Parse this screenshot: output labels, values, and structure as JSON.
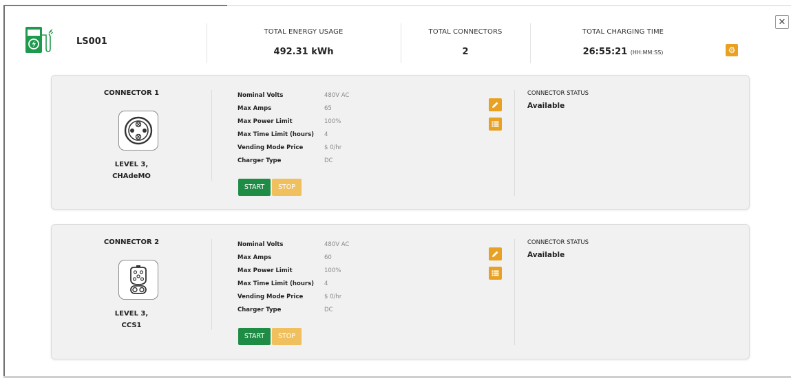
{
  "station": {
    "id": "LS001",
    "icon": "ev-charging-station-icon",
    "icon_color": "#1e9a4d"
  },
  "stats": [
    {
      "label": "TOTAL ENERGY USAGE",
      "value": "492.31 kWh",
      "unit": ""
    },
    {
      "label": "TOTAL CONNECTORS",
      "value": "2",
      "unit": ""
    },
    {
      "label": "TOTAL CHARGING TIME",
      "value": "26:55:21",
      "unit": "(HH:MM:SS)"
    }
  ],
  "connectors": [
    {
      "title": "CONNECTOR 1",
      "icon": "chademo-plug-icon",
      "type_line1": "LEVEL 3,",
      "type_line2": "CHAdeMO",
      "specs": [
        {
          "label": "Nominal Volts",
          "value": "480V AC"
        },
        {
          "label": "Max Amps",
          "value": "65"
        },
        {
          "label": "Max Power Limit",
          "value": "100%"
        },
        {
          "label": "Max Time Limit (hours)",
          "value": "4"
        },
        {
          "label": "Vending Mode Price",
          "value": "$ 0/hr"
        },
        {
          "label": "Charger Type",
          "value": "DC"
        }
      ],
      "start_label": "START",
      "stop_label": "STOP",
      "status_label": "CONNECTOR STATUS",
      "status_value": "Available"
    },
    {
      "title": "CONNECTOR 2",
      "icon": "ccs1-plug-icon",
      "type_line1": "LEVEL 3,",
      "type_line2": "CCS1",
      "specs": [
        {
          "label": "Nominal Volts",
          "value": "480V AC"
        },
        {
          "label": "Max Amps",
          "value": "60"
        },
        {
          "label": "Max Power Limit",
          "value": "100%"
        },
        {
          "label": "Max Time Limit (hours)",
          "value": "4"
        },
        {
          "label": "Vending Mode Price",
          "value": "$ 0/hr"
        },
        {
          "label": "Charger Type",
          "value": "DC"
        }
      ],
      "start_label": "START",
      "stop_label": "STOP",
      "status_label": "CONNECTOR STATUS",
      "status_value": "Available"
    }
  ],
  "colors": {
    "accent_orange": "#e8a123",
    "start_green": "#1e8c45",
    "stop_disabled": "#f0c05e"
  },
  "close_icon": "close-icon",
  "settings_icon": "gear-icon"
}
